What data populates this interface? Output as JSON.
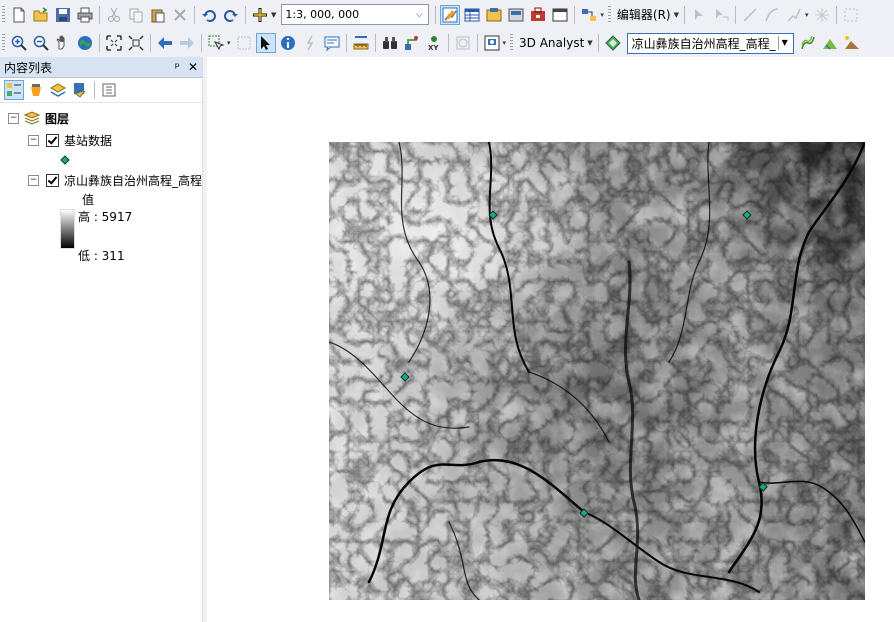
{
  "toolbar1": {
    "scale_value": "1:3, 000, 000",
    "editor_label": "编辑器(R)"
  },
  "toolbar2": {
    "analyst_label": "3D Analyst",
    "active_layer": "凉山彝族自治州高程_高程_"
  },
  "toc": {
    "title": "内容列表",
    "pin_glyph": "ᵖ",
    "close_glyph": "✕",
    "root_label": "图层",
    "layers": [
      {
        "name": "基站数据",
        "checked": true
      },
      {
        "name": "凉山彝族自治州高程_高程",
        "checked": true,
        "legend_heading": "值",
        "high_label": "高 : 5917",
        "low_label": "低 : 311"
      }
    ]
  },
  "map": {
    "point_color": "#1fa58c",
    "background": "#ffffff"
  }
}
